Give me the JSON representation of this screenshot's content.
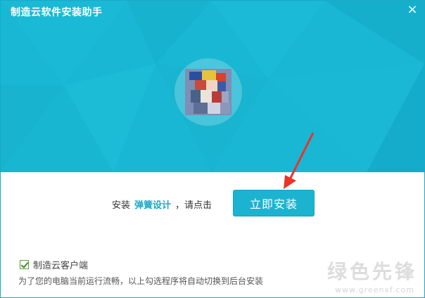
{
  "window": {
    "title": "制造云软件安装助手",
    "close_symbol": "×"
  },
  "header": {
    "background_color": "#19b7d3",
    "avatar_icon": "app-avatar-icon"
  },
  "install": {
    "prefix": "安装",
    "product_name": "弹簧设计",
    "suffix": "，请点击",
    "button_label": "立即安装",
    "accent_color": "#1cb3d1"
  },
  "options": {
    "client_checkbox_label": "制造云客户端",
    "client_checked": true,
    "note": "为了您的电脑当前运行流畅，以上勾选程序将自动切换到后台安装"
  },
  "watermark": {
    "text": "绿色先锋",
    "url": "www.greenxf.com"
  }
}
